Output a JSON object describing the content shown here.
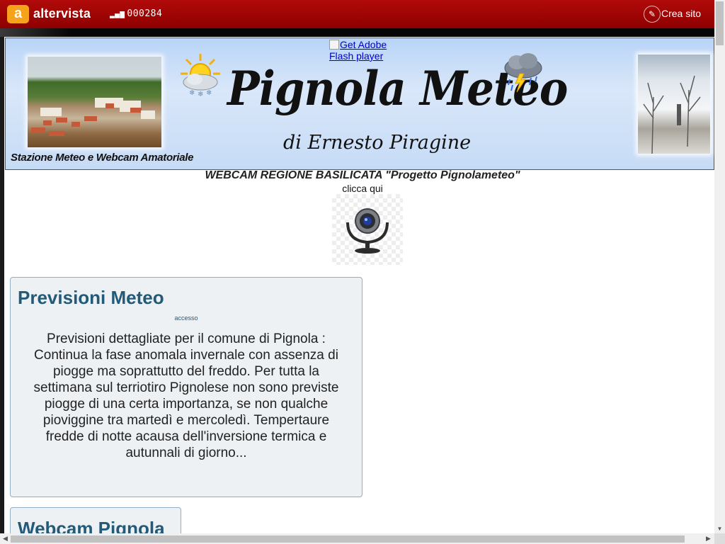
{
  "altervista": {
    "logo_letter": "a",
    "brand": "altervista",
    "counter": "000284",
    "create_site": "Crea sito",
    "accent": "#a30000"
  },
  "banner": {
    "flash_alt": "Get Adobe Flash player",
    "title": "Pignola Meteo",
    "author": "di Ernesto Piragine",
    "subtitle": "Stazione Meteo e Webcam Amatoriale"
  },
  "webcam": {
    "title": "WEBCAM REGIONE BASILICATA \"Progetto Pignolameteo\"",
    "click_here": "clicca qui"
  },
  "cards": [
    {
      "title": "Previsioni Meteo",
      "small_link": "accesso",
      "body": "Previsioni dettagliate per il comune di Pignola : Continua la fase anomala invernale con assenza di piogge ma soprattutto del freddo. Per tutta la settimana sul terriotiro Pignolese non sono previste piogge di una certa importanza, se non qualche pioviggine tra martedì e mercoledì. Tempertaure fredde di notte acausa dell'inversione termica e autunnali di giorno..."
    },
    {
      "title": "Webcam Pignola"
    }
  ]
}
